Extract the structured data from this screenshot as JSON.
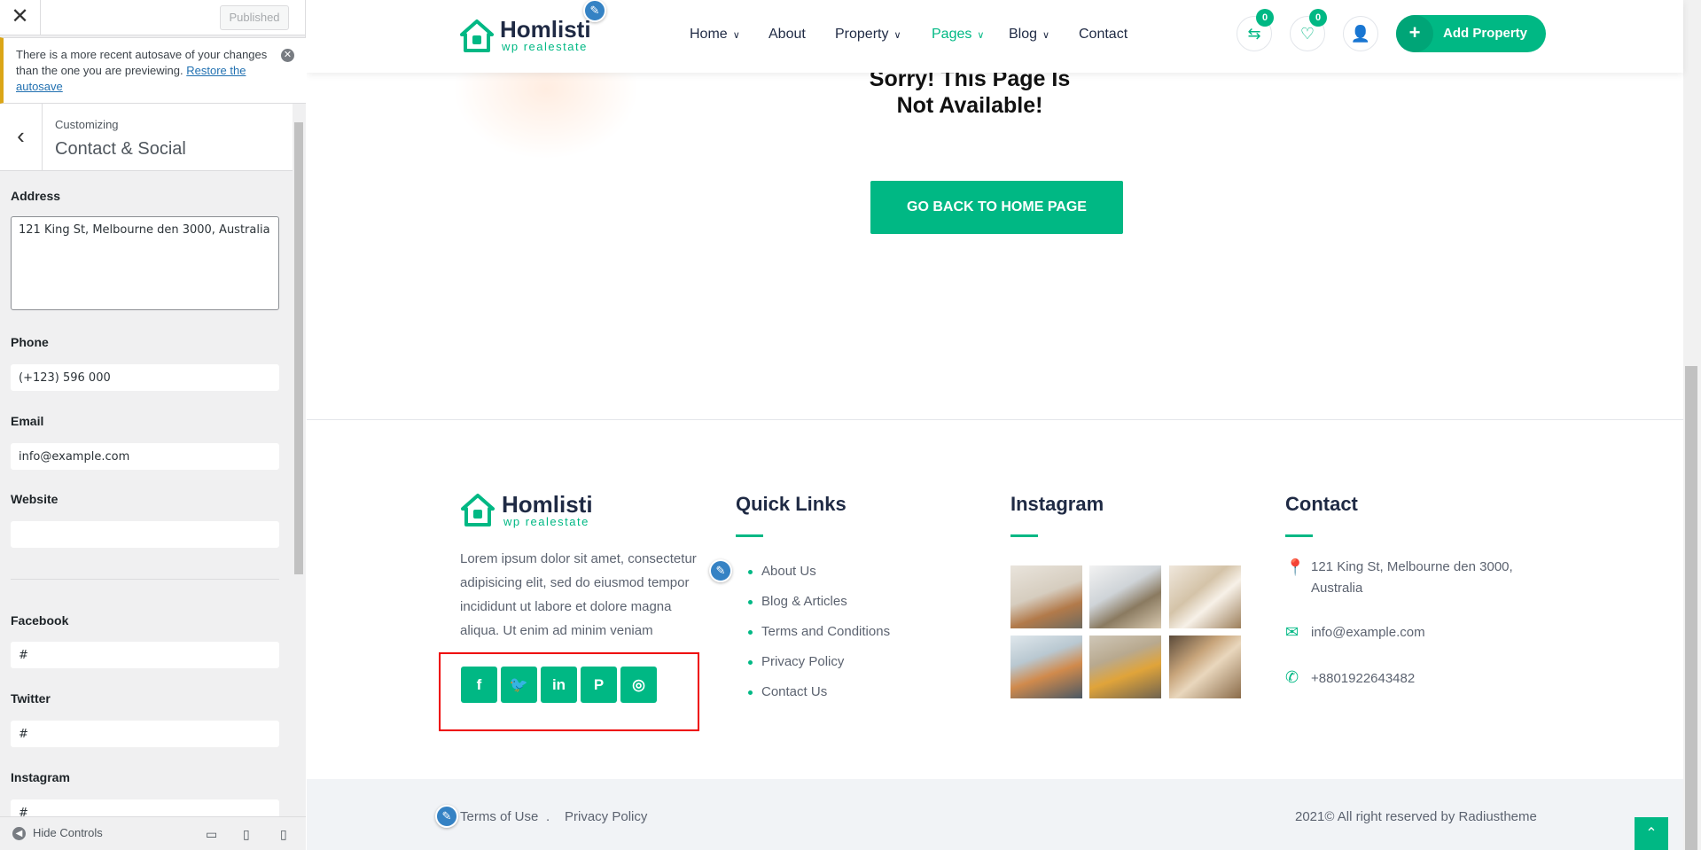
{
  "customizer": {
    "close_icon": "close-icon",
    "publish_label": "Published",
    "notice": {
      "text": "There is a more recent autosave of your changes than the one you are previewing.",
      "link": "Restore the autosave"
    },
    "breadcrumb": "Customizing",
    "section_title": "Contact & Social",
    "fields": {
      "address": {
        "label": "Address",
        "value": "121 King St, Melbourne den 3000, Australia"
      },
      "phone": {
        "label": "Phone",
        "value": "(+123) 596 000"
      },
      "email": {
        "label": "Email",
        "value": "info@example.com"
      },
      "website": {
        "label": "Website",
        "value": ""
      },
      "facebook": {
        "label": "Facebook",
        "value": "#"
      },
      "twitter": {
        "label": "Twitter",
        "value": "#"
      },
      "instagram": {
        "label": "Instagram",
        "value": "#"
      }
    },
    "hide_controls": "Hide Controls"
  },
  "site": {
    "logo": {
      "title": "Homlisti",
      "subtitle": "wp realestate"
    },
    "nav": [
      {
        "label": "Home",
        "dropdown": true
      },
      {
        "label": "About",
        "dropdown": false
      },
      {
        "label": "Property",
        "dropdown": true
      },
      {
        "label": "Pages",
        "dropdown": true,
        "active": true
      },
      {
        "label": "Blog",
        "dropdown": true
      },
      {
        "label": "Contact",
        "dropdown": false
      }
    ],
    "compare_count": "0",
    "favorite_count": "0",
    "add_property": "Add Property",
    "error": {
      "heading": "Sorry! This Page Is Not Available!",
      "button": "GO BACK TO HOME PAGE"
    },
    "footer": {
      "description": "Lorem ipsum dolor sit amet, consectetur adipisicing elit, sed do eiusmod tempor incididunt ut labore et dolore magna aliqua. Ut enim ad minim veniam",
      "social": [
        "facebook-icon",
        "twitter-icon",
        "linkedin-icon",
        "pinterest-icon",
        "instagram-icon"
      ],
      "quick_links_title": "Quick Links",
      "quick_links": [
        "About Us",
        "Blog & Articles",
        "Terms and Conditions",
        "Privacy Policy",
        "Contact Us"
      ],
      "instagram_title": "Instagram",
      "contact_title": "Contact",
      "address": "121 King St, Melbourne den 3000, Australia",
      "email": "info@example.com",
      "phone": "+8801922643482"
    },
    "bottom": {
      "terms": "Terms of Use",
      "sep": ".",
      "privacy": "Privacy Policy",
      "copyright": "2021© All right reserved by Radiustheme"
    }
  },
  "colors": {
    "accent": "#00b884",
    "notice": "#dba617",
    "link": "#2271b1",
    "highlight": "#ee0000"
  }
}
